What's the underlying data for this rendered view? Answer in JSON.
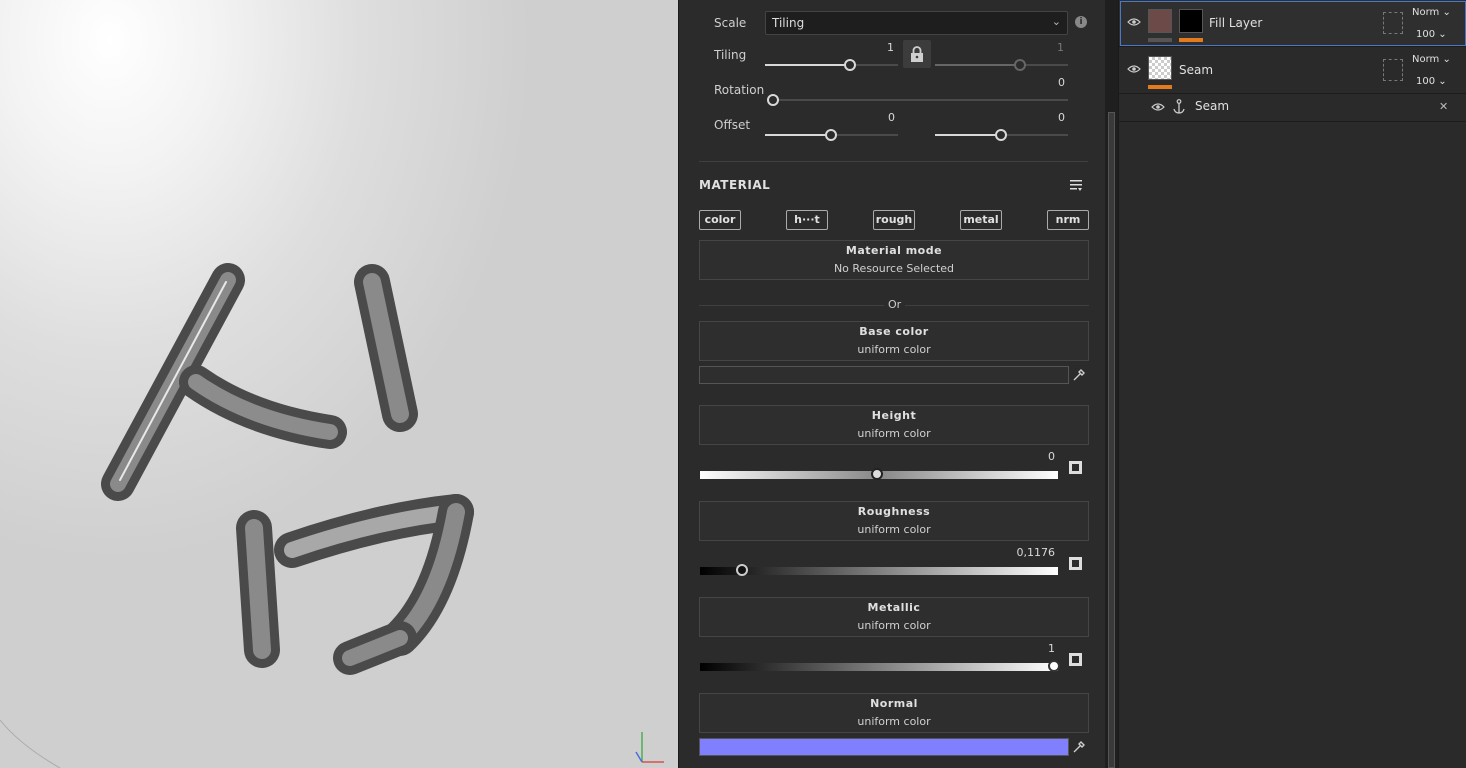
{
  "properties": {
    "scale": {
      "label": "Scale",
      "value": "Tiling"
    },
    "tiling": {
      "label": "Tiling",
      "value_u": "1",
      "value_v": "1"
    },
    "rotation": {
      "label": "Rotation",
      "value": "0"
    },
    "offset": {
      "label": "Offset",
      "value_u": "0",
      "value_v": "0"
    }
  },
  "material": {
    "section_title": "MATERIAL",
    "channels": [
      "color",
      "h···t",
      "rough",
      "metal",
      "nrm"
    ],
    "material_mode": {
      "title": "Material mode",
      "sub": "No Resource Selected"
    },
    "or_text": "Or",
    "base_color": {
      "title": "Base color",
      "sub": "uniform color",
      "swatch": "#2e2e2e"
    },
    "height": {
      "title": "Height",
      "sub": "uniform color",
      "value": "0",
      "fraction": 0.5
    },
    "roughness": {
      "title": "Roughness",
      "sub": "uniform color",
      "value": "0,1176",
      "fraction": 0.1176
    },
    "metallic": {
      "title": "Metallic",
      "sub": "uniform color",
      "value": "1",
      "fraction": 1.0
    },
    "normal": {
      "title": "Normal",
      "sub": "uniform color",
      "swatch": "#8080ff"
    }
  },
  "layers": [
    {
      "name": "Fill Layer",
      "blend": "Norm",
      "opacity": "100",
      "selected": true,
      "thumb_color": "#6b4a48"
    },
    {
      "name": "Seam",
      "blend": "Norm",
      "opacity": "100",
      "selected": false
    },
    {
      "name": "Seam",
      "type": "anchor"
    }
  ],
  "colors": {
    "accent": "#e07b20",
    "selection": "#4a78c8"
  }
}
